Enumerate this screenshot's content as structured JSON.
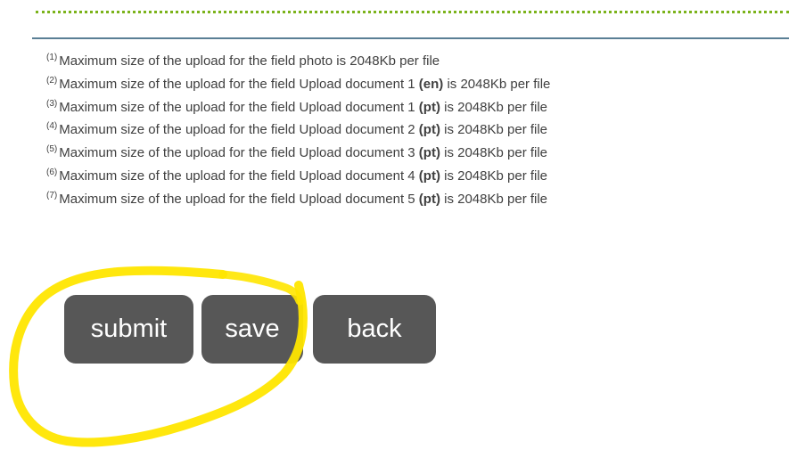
{
  "notes": [
    {
      "num": "(1)",
      "before": "Maximum size of the upload for the field photo is 2048Kb per file",
      "lang": "",
      "after": ""
    },
    {
      "num": "(2)",
      "before": "Maximum size of the upload for the field Upload document 1 ",
      "lang": "(en)",
      "after": " is 2048Kb per file"
    },
    {
      "num": "(3)",
      "before": "Maximum size of the upload for the field Upload document 1 ",
      "lang": "(pt)",
      "after": " is 2048Kb per file"
    },
    {
      "num": "(4)",
      "before": "Maximum size of the upload for the field Upload document 2 ",
      "lang": "(pt)",
      "after": " is 2048Kb per file"
    },
    {
      "num": "(5)",
      "before": "Maximum size of the upload for the field Upload document 3 ",
      "lang": "(pt)",
      "after": " is 2048Kb per file"
    },
    {
      "num": "(6)",
      "before": "Maximum size of the upload for the field Upload document 4 ",
      "lang": "(pt)",
      "after": " is 2048Kb per file"
    },
    {
      "num": "(7)",
      "before": "Maximum size of the upload for the field Upload document 5 ",
      "lang": "(pt)",
      "after": " is 2048Kb per file"
    }
  ],
  "buttons": {
    "submit": "submit",
    "save": "save",
    "back": "back"
  },
  "colors": {
    "button_bg": "#575757",
    "button_text": "#ffffff",
    "dotted_divider": "#7bb31a",
    "solid_divider": "#5a7f95",
    "highlight_annotation": "#ffe600"
  }
}
